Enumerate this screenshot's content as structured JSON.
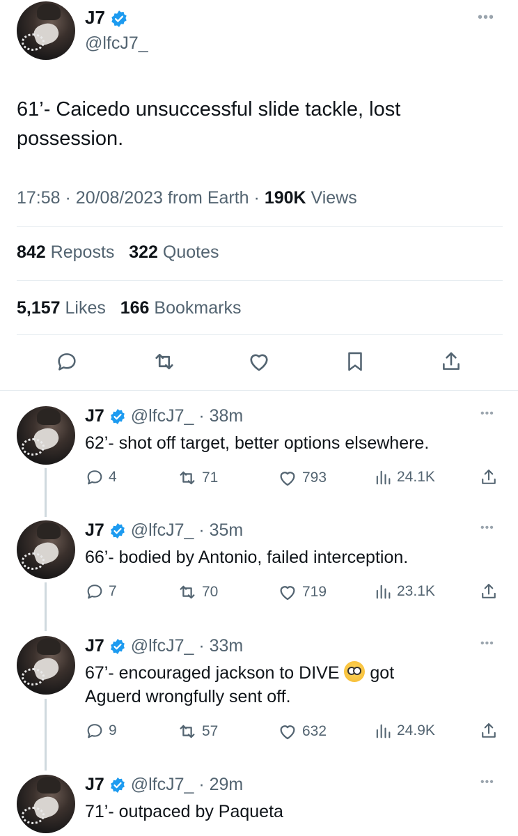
{
  "main": {
    "name": "J7",
    "handle": "@lfcJ7_",
    "text": "61’- Caicedo unsuccessful slide tackle, lost possession.",
    "time": "17:58",
    "date": "20/08/2023",
    "source": "from Earth",
    "views_count": "190K",
    "views_label": "Views",
    "reposts_count": "842",
    "reposts_label": "Reposts",
    "quotes_count": "322",
    "quotes_label": "Quotes",
    "likes_count": "5,157",
    "likes_label": "Likes",
    "bookmarks_count": "166",
    "bookmarks_label": "Bookmarks"
  },
  "replies": [
    {
      "name": "J7",
      "handle": "@lfcJ7_",
      "age": "38m",
      "text": "62’- shot off target, better options elsewhere.",
      "replies": "4",
      "reposts": "71",
      "likes": "793",
      "views": "24.1K"
    },
    {
      "name": "J7",
      "handle": "@lfcJ7_",
      "age": "35m",
      "text": "66’- bodied by Antonio, failed interception.",
      "replies": "7",
      "reposts": "70",
      "likes": "719",
      "views": "23.1K"
    },
    {
      "name": "J7",
      "handle": "@lfcJ7_",
      "age": "33m",
      "text_part1": "67’- encouraged jackson to DIVE",
      "text_part2": "got",
      "text_line2": "Aguerd wrongfully sent off.",
      "replies": "9",
      "reposts": "57",
      "likes": "632",
      "views": "24.9K"
    },
    {
      "name": "J7",
      "handle": "@lfcJ7_",
      "age": "29m",
      "text": "71’- outpaced by Paqueta"
    }
  ],
  "colors": {
    "accent": "#1d9bf0",
    "muted": "#536471",
    "text": "#0f1419"
  }
}
